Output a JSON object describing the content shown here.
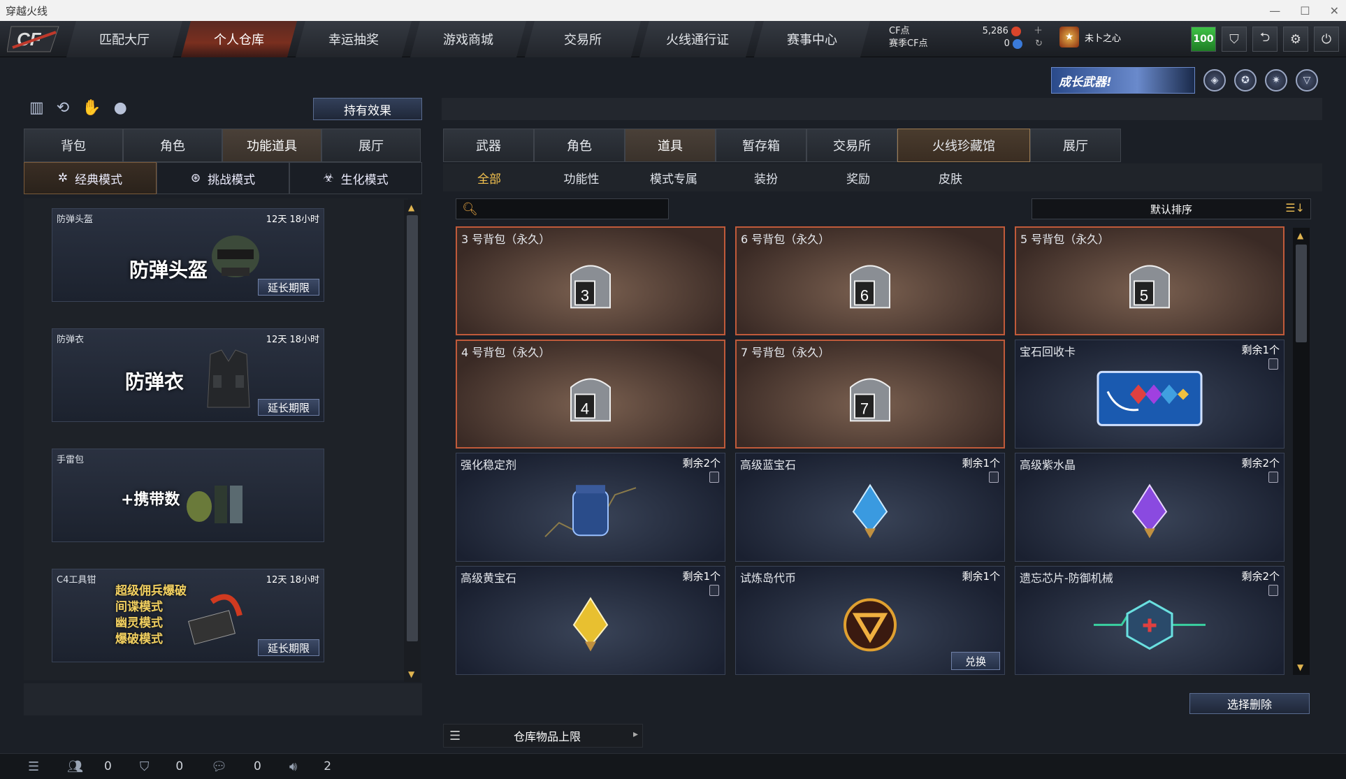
{
  "window": {
    "title": "穿越火线"
  },
  "nav": {
    "items": [
      "匹配大厅",
      "个人仓库",
      "幸运抽奖",
      "游戏商城",
      "交易所",
      "火线通行证",
      "赛事中心"
    ],
    "active_index": 1
  },
  "currency": {
    "cf_label": "CF点",
    "cf_value": "5,286",
    "season_label": "赛季CF点",
    "season_value": "0"
  },
  "user": {
    "name": "未卜之心",
    "level": "100"
  },
  "banner": {
    "text": "成长武器!"
  },
  "left": {
    "effect_button": "持有效果",
    "tabs": [
      "背包",
      "角色",
      "功能道具",
      "展厅"
    ],
    "active_tab": 2,
    "modes": [
      "经典模式",
      "挑战模式",
      "生化模式"
    ],
    "active_mode": 0,
    "items": [
      {
        "name": "防弹头盔",
        "time": "12天 18小时",
        "big": "防弹头盔",
        "extend": "延长期限"
      },
      {
        "name": "防弹衣",
        "time": "12天 18小时",
        "big": "防弹衣",
        "extend": "延长期限"
      },
      {
        "name": "手雷包",
        "time": "",
        "big": "+携带数",
        "extend": ""
      },
      {
        "name": "C4工具钳",
        "time": "12天 18小时",
        "big": "超级佣兵爆破\n间谍模式\n幽灵模式\n爆破模式",
        "extend": "延长期限"
      }
    ]
  },
  "right": {
    "tabs": [
      "武器",
      "角色",
      "道具",
      "暂存箱",
      "交易所",
      "火线珍藏馆",
      "展厅"
    ],
    "active_tab": 2,
    "subtabs": [
      "全部",
      "功能性",
      "模式专属",
      "装扮",
      "奖励",
      "皮肤"
    ],
    "active_subtab": 0,
    "search_placeholder": "",
    "sort_label": "默认排序",
    "items": [
      {
        "name": "3 号背包（永久）",
        "count": "",
        "type": "bag",
        "bag": "3"
      },
      {
        "name": "6 号背包（永久）",
        "count": "",
        "type": "bag",
        "bag": "6"
      },
      {
        "name": "5 号背包（永久）",
        "count": "",
        "type": "bag",
        "bag": "5"
      },
      {
        "name": "4 号背包（永久）",
        "count": "",
        "type": "bag",
        "bag": "4"
      },
      {
        "name": "7 号背包（永久）",
        "count": "",
        "type": "bag",
        "bag": "7"
      },
      {
        "name": "宝石回收卡",
        "count": "剩余1个",
        "type": "card"
      },
      {
        "name": "强化稳定剂",
        "count": "剩余2个",
        "type": "stabilizer"
      },
      {
        "name": "高级蓝宝石",
        "count": "剩余1个",
        "type": "gem-blue"
      },
      {
        "name": "高级紫水晶",
        "count": "剩余2个",
        "type": "gem-purple"
      },
      {
        "name": "高级黄宝石",
        "count": "剩余1个",
        "type": "gem-yellow"
      },
      {
        "name": "试炼岛代币",
        "count": "剩余1个",
        "type": "coin",
        "redeem": "兑换"
      },
      {
        "name": "遗忘芯片-防御机械",
        "count": "剩余2个",
        "type": "chip"
      }
    ],
    "delete_button": "选择删除",
    "capacity_label": "仓库物品上限"
  },
  "statusbar": {
    "v1": "0",
    "v2": "0",
    "v3": "0",
    "v4": "2"
  },
  "colors": {
    "accent": "#f2c14e",
    "bag_border": "#c05a3a",
    "active_nav": "#7a2f1f",
    "level_green": "#3fc247"
  }
}
